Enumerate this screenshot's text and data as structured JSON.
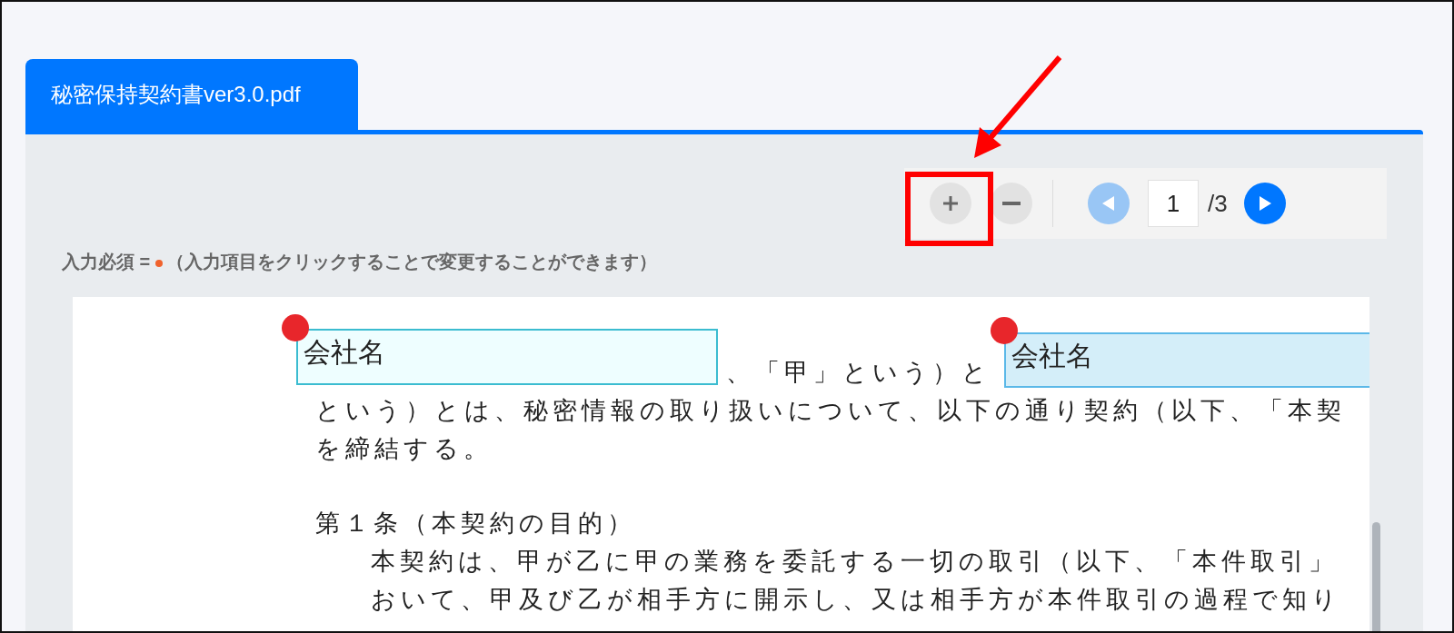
{
  "tabs": [
    {
      "label": "秘密保持契約書ver3.0.pdf",
      "selected": true
    }
  ],
  "toolbar": {
    "zoom_in": {
      "disabled": false
    },
    "zoom_out": {
      "disabled": false
    },
    "prev_page": {
      "disabled": true
    },
    "page_input": {
      "value": "1"
    },
    "page_total": "/3",
    "next_page": {
      "disabled": false
    }
  },
  "legend": {
    "label": "入力必須 =",
    "note": "（入力項目をクリックすることで変更することができます）"
  },
  "document": {
    "fields": [
      {
        "value": "会社名",
        "required": true,
        "selected": false
      },
      {
        "value": "会社名",
        "required": true,
        "selected": true
      }
    ],
    "lines": [
      {
        "kind": "fragment",
        "text": "、「甲」という）と"
      },
      {
        "kind": "text",
        "text": "という）とは、秘密情報の取り扱いについて、以下の通り契約（以下、「本契"
      },
      {
        "kind": "text",
        "text": "を締結する。"
      },
      {
        "kind": "heading",
        "text": "第１条（本契約の目的）"
      },
      {
        "kind": "indented",
        "text": "本契約は、甲が乙に甲の業務を委託する一切の取引（以下、「本件取引」"
      },
      {
        "kind": "indented",
        "text": "おいて、甲及び乙が相手方に開示し、又は相手方が本件取引の過程で知り"
      }
    ]
  }
}
